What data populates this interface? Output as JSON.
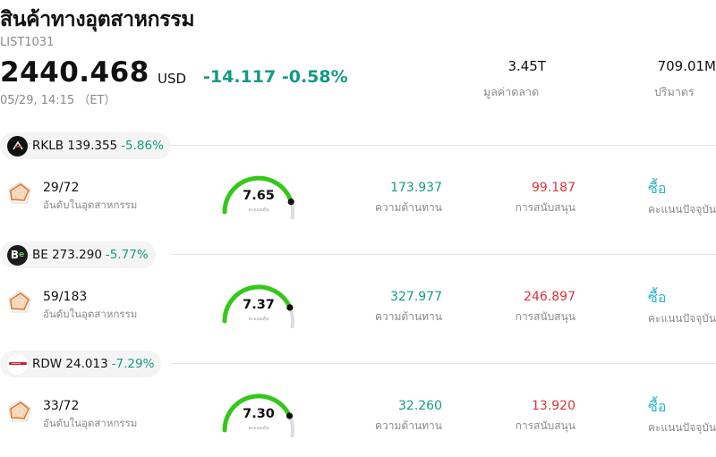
{
  "header": {
    "title": "สินค้าทางอุตสาหกรรม",
    "code": "LIST1031",
    "price": "2440.468",
    "currency": "USD",
    "change": "-14.117",
    "change_pct": "-0.58%",
    "timestamp": "05/29, 14:15 （ET）",
    "market_cap_value": "3.45T",
    "market_cap_label": "มูลค่าตลาด",
    "volume_value": "709.01M",
    "volume_label": "ปริมาตร"
  },
  "colors": {
    "up_green": "#129b82",
    "down_red": "#e0323b",
    "signal_cyan": "#2bb5c2",
    "gauge_green": "#34c81a"
  },
  "stocks": [
    {
      "ticker": "RKLB",
      "price": "139.355",
      "change_pct": "-5.86%",
      "logo_icon": "rklb-logo-icon",
      "rank": "29/72",
      "rank_label": "อันดับในอุตสาหกรรม",
      "score": "7.65",
      "score_label": "คะแนนหุ้น",
      "score_fraction": 0.765,
      "resistance": "173.937",
      "resistance_label": "ความต้านทาน",
      "support": "99.187",
      "support_label": "การสนับสนุน",
      "signal": "ซื้อ",
      "signal_label": "คะแนนปัจจุบัน"
    },
    {
      "ticker": "BE",
      "price": "273.290",
      "change_pct": "-5.77%",
      "logo_icon": "be-logo-icon",
      "rank": "59/183",
      "rank_label": "อันดับในอุตสาหกรรม",
      "score": "7.37",
      "score_label": "คะแนนหุ้น",
      "score_fraction": 0.737,
      "resistance": "327.977",
      "resistance_label": "ความต้านทาน",
      "support": "246.897",
      "support_label": "การสนับสนุน",
      "signal": "ซื้อ",
      "signal_label": "คะแนนปัจจุบัน"
    },
    {
      "ticker": "RDW",
      "price": "24.013",
      "change_pct": "-7.29%",
      "logo_icon": "rdw-logo-icon",
      "rank": "33/72",
      "rank_label": "อันดับในอุตสาหกรรม",
      "score": "7.30",
      "score_label": "คะแนนหุ้น",
      "score_fraction": 0.73,
      "resistance": "32.260",
      "resistance_label": "ความต้านทาน",
      "support": "13.920",
      "support_label": "การสนับสนุน",
      "signal": "ซื้อ",
      "signal_label": "คะแนนปัจจุบัน"
    }
  ]
}
